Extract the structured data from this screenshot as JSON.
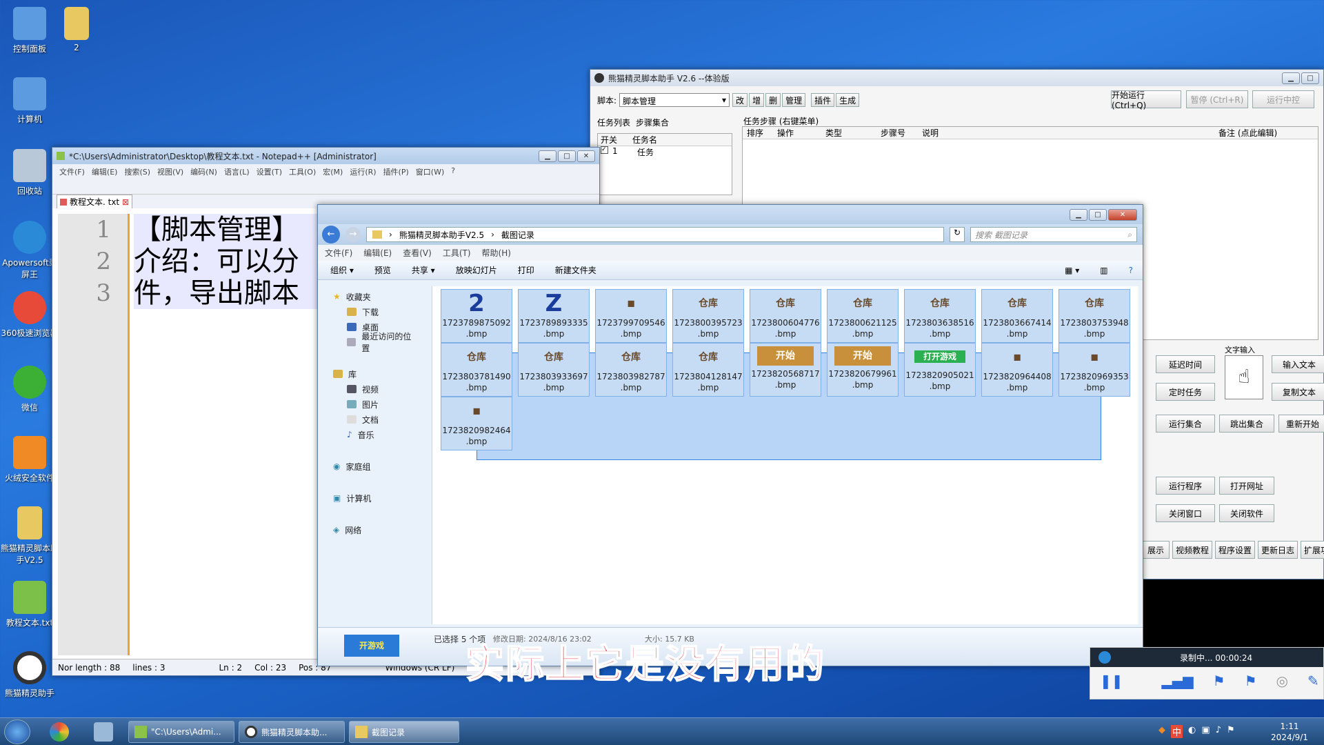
{
  "desktop": {
    "icons": [
      {
        "label": "控制面板",
        "color": "#5c9be0"
      },
      {
        "label": "2",
        "color": "#e8c860"
      },
      {
        "label": "计算机",
        "color": "#5c9be0"
      },
      {
        "label": "回收站",
        "color": "#b8c8d8"
      },
      {
        "label": "Apowersoft录屏王",
        "color": "#2a8ad8"
      },
      {
        "label": "360极速浏览器",
        "color": "#e84a3a"
      },
      {
        "label": "微信",
        "color": "#3cb034"
      },
      {
        "label": "火绒安全软件",
        "color": "#f08a24"
      },
      {
        "label": "熊猫精灵脚本助手V2.5",
        "color": "#e8c860"
      },
      {
        "label": "教程文本.txt",
        "color": "#7cc04a"
      },
      {
        "label": "熊猫精灵助手",
        "color": "#333333"
      }
    ]
  },
  "notepad": {
    "title": "*C:\\Users\\Administrator\\Desktop\\教程文本.txt - Notepad++ [Administrator]",
    "menu": [
      "文件(F)",
      "编辑(E)",
      "搜索(S)",
      "视图(V)",
      "编码(N)",
      "语言(L)",
      "设置(T)",
      "工具(O)",
      "宏(M)",
      "运行(R)",
      "插件(P)",
      "窗口(W)",
      "?"
    ],
    "tab": "教程文本. txt",
    "lines": [
      "1",
      "2",
      "",
      "3"
    ],
    "text": [
      "【脚本管理】",
      "介绍：可以分",
      "件，导出脚本"
    ],
    "status": {
      "length": "Nor length : 88",
      "lines": "lines : 3",
      "ln": "Ln : 2",
      "col": "Col : 23",
      "pos": "Pos : 87",
      "eol": "Windows (CR LF)"
    }
  },
  "helper": {
    "title": "熊猫精灵脚本助手  V2.6  --体验版",
    "script_label": "脚本:",
    "script_value": "脚本管理",
    "small_btns": [
      "改",
      "增",
      "删",
      "管理",
      "插件",
      "生成"
    ],
    "run_btn": "开始运行 (Ctrl+Q)",
    "pause_btn": "暂停 (Ctrl+R)",
    "stop_btn": "运行中控",
    "tabs": [
      "任务列表",
      "步骤集合"
    ],
    "task_cols": [
      "开关",
      "任务名"
    ],
    "task_row": {
      "num": "1",
      "name": "任务"
    },
    "steps_title": "任务步骤 (右键菜单)",
    "step_cols": [
      "排序",
      "操作",
      "类型",
      "步骤号",
      "说明",
      "备注 (点此编辑)"
    ],
    "text_input_label": "文字输入",
    "buttons": [
      "延迟时间",
      "输入文本",
      "定时任务",
      "复制文本",
      "运行集合",
      "跳出集合",
      "重新开始",
      "运行程序",
      "打开网址",
      "关闭窗口",
      "关闭软件"
    ],
    "bottom_btns": [
      "展示",
      "视频教程",
      "程序设置",
      "更新日志",
      "扩展功能"
    ]
  },
  "explorer": {
    "path": [
      "熊猫精灵脚本助手V2.5",
      "截图记录"
    ],
    "search_placeholder": "搜索 截图记录",
    "menu": [
      "文件(F)",
      "编辑(E)",
      "查看(V)",
      "工具(T)",
      "帮助(H)"
    ],
    "toolbar": [
      "组织 ▾",
      "预览",
      "共享 ▾",
      "放映幻灯片",
      "打印",
      "新建文件夹"
    ],
    "tree": {
      "favorites": "收藏夹",
      "fav_items": [
        "下载",
        "桌面",
        "最近访问的位置"
      ],
      "library": "库",
      "lib_items": [
        "视频",
        "图片",
        "文档",
        "音乐"
      ],
      "homegroup": "家庭组",
      "computer": "计算机",
      "network": "网络"
    },
    "files": [
      {
        "name": "1723789875092",
        "ext": ".bmp",
        "img": "2"
      },
      {
        "name": "1723789893335",
        "ext": ".bmp",
        "img": "Z"
      },
      {
        "name": "1723799709546",
        "ext": ".bmp",
        "img": "◼"
      },
      {
        "name": "1723800395723",
        "ext": ".bmp",
        "img": "仓库"
      },
      {
        "name": "1723800604776",
        "ext": ".bmp",
        "img": "仓库"
      },
      {
        "name": "1723800621125",
        "ext": ".bmp",
        "img": "仓库"
      },
      {
        "name": "1723803638516",
        "ext": ".bmp",
        "img": "仓库"
      },
      {
        "name": "1723803667414",
        "ext": ".bmp",
        "img": "仓库"
      },
      {
        "name": "1723803753948",
        "ext": ".bmp",
        "img": "仓库"
      },
      {
        "name": "1723803781490",
        "ext": ".bmp",
        "img": "仓库"
      },
      {
        "name": "1723803933697",
        "ext": ".bmp",
        "img": "仓库"
      },
      {
        "name": "1723803982787",
        "ext": ".bmp",
        "img": "仓库"
      },
      {
        "name": "1723804128147",
        "ext": ".bmp",
        "img": "仓库"
      },
      {
        "name": "1723820568717",
        "ext": ".bmp",
        "img": "开始"
      },
      {
        "name": "1723820679961",
        "ext": ".bmp",
        "img": "开始"
      },
      {
        "name": "1723820905021",
        "ext": ".bmp",
        "img": "打开游戏"
      },
      {
        "name": "1723820964408",
        "ext": ".bmp",
        "img": "◼"
      },
      {
        "name": "1723820969353",
        "ext": ".bmp",
        "img": "◼"
      },
      {
        "name": "1723820982464",
        "ext": ".bmp",
        "img": "◼"
      }
    ],
    "status": {
      "selected": "已选择 5 个项",
      "modified": "修改日期: 2024/8/16 23:02",
      "size": "大小: 15.7 KB",
      "thumb_label": "开游戏"
    }
  },
  "subtitle": "实际上它是没有用的",
  "recorder": {
    "label": "录制中... 00:00:24"
  },
  "taskbar": {
    "items": [
      "\"C:\\Users\\Admi...",
      "熊猫精灵脚本助...",
      "截图记录"
    ],
    "time": "1:11",
    "date": "2024/9/1",
    "tray": "中"
  }
}
